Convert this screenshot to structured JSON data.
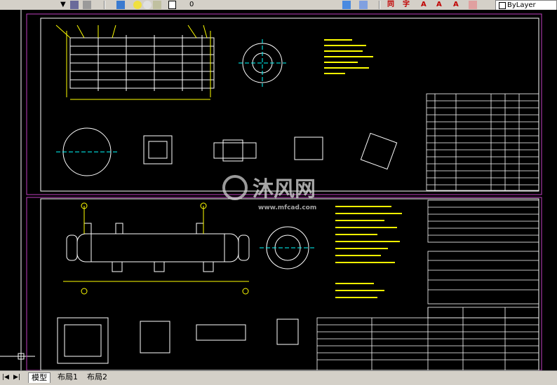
{
  "toolbar": {
    "layer_value": "0",
    "linetype_value": "ByLayer",
    "text_style_icons": [
      "同",
      "字",
      "A",
      "A",
      "A"
    ]
  },
  "canvas": {
    "watermark_text": "沐风网",
    "watermark_url": "www.mfcad.com"
  },
  "tabs": [
    {
      "label": "模型",
      "active": true
    },
    {
      "label": "布局1",
      "active": false
    },
    {
      "label": "布局2",
      "active": false
    }
  ],
  "colors": {
    "background": "#000000",
    "border_magenta": "#c040c0",
    "linework_white": "#ffffff",
    "linework_yellow": "#ffff00",
    "linework_cyan": "#00ffff",
    "linework_green": "#00ff00"
  }
}
